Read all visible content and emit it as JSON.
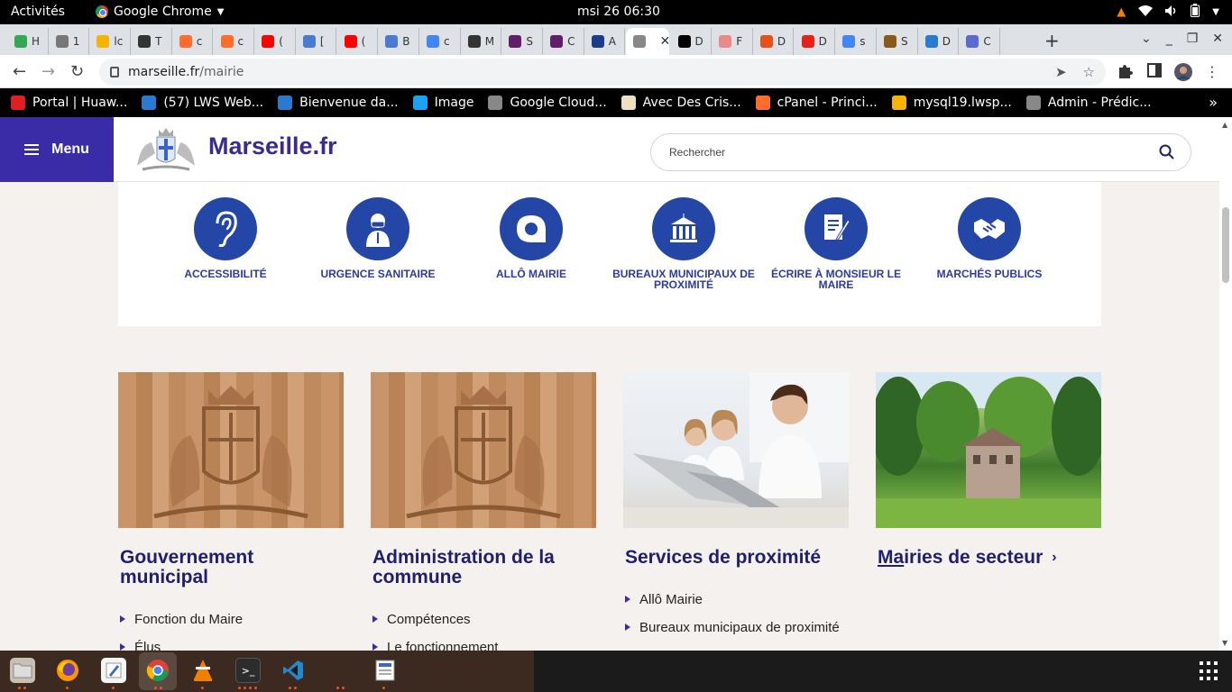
{
  "topbar": {
    "activities": "Activités",
    "app_name": "Google Chrome",
    "clock": "msi 26  06:30"
  },
  "tabs": [
    {
      "label": "H",
      "icon": "green-circle-icon",
      "color": "#34a853"
    },
    {
      "label": "1",
      "icon": "globe-icon",
      "color": "#777777"
    },
    {
      "label": "lc",
      "icon": "pma-icon",
      "color": "#f4b400"
    },
    {
      "label": "T",
      "icon": "telegram-icon",
      "color": "#333333"
    },
    {
      "label": "c",
      "icon": "cpanel-icon",
      "color": "#ff6c2c"
    },
    {
      "label": "c",
      "icon": "cpanel-icon",
      "color": "#ff6c2c"
    },
    {
      "label": "(",
      "icon": "youtube-icon",
      "color": "#ff0000"
    },
    {
      "label": "[",
      "icon": "grid-icon",
      "color": "#4a7bd0"
    },
    {
      "label": "(",
      "icon": "youtube-icon",
      "color": "#ff0000"
    },
    {
      "label": "B",
      "icon": "grid-icon",
      "color": "#4a7bd0"
    },
    {
      "label": "c",
      "icon": "google-icon",
      "color": "#4285f4"
    },
    {
      "label": "M",
      "icon": "openai-icon",
      "color": "#333333"
    },
    {
      "label": "S",
      "icon": "slack-icon",
      "color": "#611f69"
    },
    {
      "label": "C",
      "icon": "slack-icon",
      "color": "#611f69"
    },
    {
      "label": "A",
      "icon": "flag-icon",
      "color": "#1a3c8c"
    },
    {
      "label": "",
      "icon": "marseille-crest-icon",
      "color": "#888888",
      "active": true
    },
    {
      "label": "D",
      "icon": "m-icon",
      "color": "#000000"
    },
    {
      "label": "F",
      "icon": "pattern-icon",
      "color": "#e88a8a"
    },
    {
      "label": "D",
      "icon": "orange-icon",
      "color": "#e8501a"
    },
    {
      "label": "D",
      "icon": "zip-icon",
      "color": "#e8201a"
    },
    {
      "label": "s",
      "icon": "google-icon",
      "color": "#4285f4"
    },
    {
      "label": "S",
      "icon": "book-icon",
      "color": "#8a5a1a"
    },
    {
      "label": "D",
      "icon": "blue-square-icon",
      "color": "#2a7ad0"
    },
    {
      "label": "C",
      "icon": "doc-icon",
      "color": "#5a6ad0"
    }
  ],
  "address": {
    "domain": "marseille.fr",
    "path": "/mairie"
  },
  "bookmarks": [
    {
      "label": "Portal | Huaw...",
      "icon": "huawei-icon",
      "color": "#e02020"
    },
    {
      "label": "(57) LWS Web...",
      "icon": "lws-icon",
      "color": "#2a7ad0"
    },
    {
      "label": "Bienvenue da...",
      "icon": "box-icon",
      "color": "#2a7ad0"
    },
    {
      "label": "Image",
      "icon": "twitter-icon",
      "color": "#1da1f2"
    },
    {
      "label": "Google Cloud...",
      "icon": "gear-icon",
      "color": "#888888"
    },
    {
      "label": "Avec Des Cris...",
      "icon": "page-icon",
      "color": "#f0e0c0"
    },
    {
      "label": "cPanel - Princi...",
      "icon": "cpanel-icon",
      "color": "#ff6c2c"
    },
    {
      "label": "mysql19.lwsp...",
      "icon": "pma-icon",
      "color": "#f4b400"
    },
    {
      "label": "Admin - Prédic...",
      "icon": "edge-icon",
      "color": "#888888"
    }
  ],
  "site": {
    "menu_label": "Menu",
    "title": "Marseille.fr",
    "search_placeholder": "Rechercher"
  },
  "quick_links": [
    {
      "label": "Accessibilité",
      "icon": "ear-icon"
    },
    {
      "label": "Urgence sanitaire",
      "icon": "masked-person-icon"
    },
    {
      "label": "Allô Mairie",
      "icon": "speech-bubble-icon"
    },
    {
      "label": "Bureaux municipaux de proximité",
      "icon": "town-hall-icon"
    },
    {
      "label": "Écrire à Monsieur le Maire",
      "icon": "write-letter-icon"
    },
    {
      "label": "Marchés publics",
      "icon": "handshake-icon"
    }
  ],
  "cards": [
    {
      "title": "Gouvernement municipal",
      "image": "wood-crest-image",
      "items": [
        "Fonction du Maire",
        "Élus"
      ]
    },
    {
      "title": "Administration de la commune",
      "image": "wood-crest-image",
      "items": [
        "Compétences",
        "Le fonctionnement"
      ]
    },
    {
      "title": "Services de proximité",
      "image": "call-center-image",
      "items": [
        "Allô Mairie",
        "Bureaux municipaux de proximité"
      ]
    },
    {
      "title_underlined": "Ma",
      "title_rest": "iries de secteur",
      "image": "park-building-image",
      "items": []
    }
  ],
  "colors": {
    "brand_purple": "#3a2ca6",
    "icon_blue": "#2446a6",
    "title_navy": "#1f1f6b",
    "page_bg": "#f5f1ee"
  }
}
